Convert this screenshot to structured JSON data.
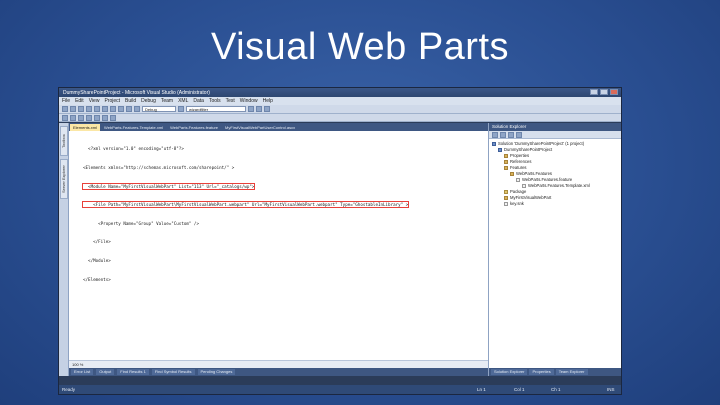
{
  "slide": {
    "title": "Visual Web Parts"
  },
  "window": {
    "title": "DummySharePointProject - Microsoft Visual Studio (Administrator)",
    "menu": [
      "File",
      "Edit",
      "View",
      "Project",
      "Build",
      "Debug",
      "Team",
      "XML",
      "Data",
      "Tools",
      "Test",
      "Window",
      "Help"
    ],
    "toolbar": {
      "config_combo": "Debug",
      "search_combo": "wizardfilter"
    }
  },
  "doc_tabs": [
    {
      "label": "Elements.xml",
      "active": true
    },
    {
      "label": "WebParts.Features.Template.xml",
      "active": false
    },
    {
      "label": "WebParts.Features.feature",
      "active": false
    },
    {
      "label": "MyFirstVisualWebPartUserControl.ascx",
      "active": false
    }
  ],
  "side_tabs": [
    "Toolbox",
    "Server Explorer"
  ],
  "code_lines": [
    "  <?xml version=\"1.0\" encoding=\"utf-8\"?>",
    "<Elements xmlns=\"http://schemas.microsoft.com/sharepoint/\" >",
    "  <Module Name=\"MyFirstVisualWebPart\" List=\"113\" Url=\"_catalogs/wp\">",
    "    <File Path=\"MyFirstVisualWebPart\\MyFirstVisualWebPart.webpart\" Url=\"MyFirstVisualWebPart.webpart\" Type=\"GhostableInLibrary\" >",
    "      <Property Name=\"Group\" Value=\"Custom\" />",
    "    </File>",
    "  </Module>",
    "</Elements>"
  ],
  "zoom": "100 %",
  "bottom_tabs": [
    "Error List",
    "Output",
    "Find Results 1",
    "Find Symbol Results",
    "Pending Changes"
  ],
  "solution_explorer": {
    "title": "Solution Explorer",
    "tree": [
      {
        "label": "Solution 'DummySharePointProject' (1 project)",
        "indent": 0,
        "icon": "proj"
      },
      {
        "label": "DummySharePointProject",
        "indent": 1,
        "icon": "proj"
      },
      {
        "label": "Properties",
        "indent": 2,
        "icon": "folder"
      },
      {
        "label": "References",
        "indent": 2,
        "icon": "folder"
      },
      {
        "label": "Features",
        "indent": 2,
        "icon": "folder"
      },
      {
        "label": "WebParts.Features",
        "indent": 3,
        "icon": "folder"
      },
      {
        "label": "WebParts.Features.feature",
        "indent": 4,
        "icon": "file"
      },
      {
        "label": "WebParts.Features.Template.xml",
        "indent": 5,
        "icon": "file"
      },
      {
        "label": "Package",
        "indent": 2,
        "icon": "pkg"
      },
      {
        "label": "MyFirstVisualWebPart",
        "indent": 2,
        "icon": "folder"
      },
      {
        "label": "key.snk",
        "indent": 2,
        "icon": "file"
      }
    ],
    "footer_tabs": [
      "Solution Explorer",
      "Properties",
      "Team Explorer"
    ]
  },
  "status": {
    "left": "Ready",
    "ln": "Ln 1",
    "col": "Col 1",
    "ch": "Ch 1",
    "mode": "INS"
  },
  "colors": {
    "slide_bg": "#2a4f92",
    "vs_dark": "#3e5782",
    "highlight": "#e8403a"
  }
}
